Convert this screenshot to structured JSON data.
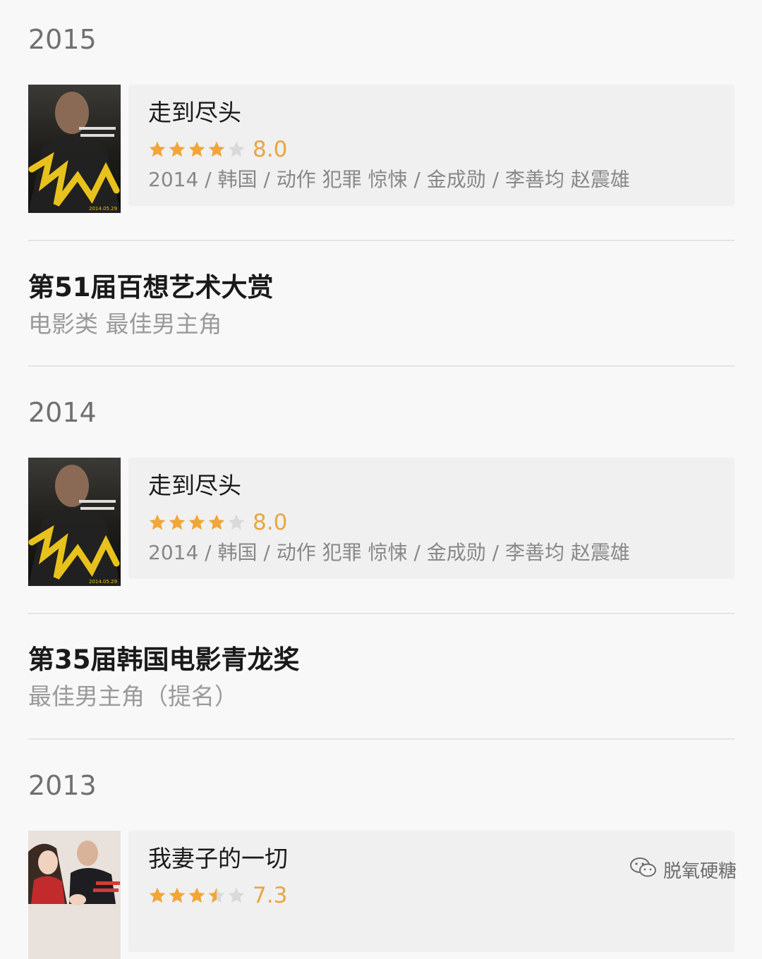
{
  "sections": [
    {
      "year": "2015",
      "movie": {
        "title": "走到尽头",
        "stars": 4,
        "score": "8.0",
        "meta": "2014 / 韩国 / 动作 犯罪 惊悚 / 金成勋 / 李善均 赵震雄",
        "poster_caption": "2014.05.29"
      },
      "award": {
        "name": "第51届百想艺术大赏",
        "category": "电影类 最佳男主角"
      }
    },
    {
      "year": "2014",
      "movie": {
        "title": "走到尽头",
        "stars": 4,
        "score": "8.0",
        "meta": "2014 / 韩国 / 动作 犯罪 惊悚 / 金成勋 / 李善均 赵震雄",
        "poster_caption": "2014.05.29"
      },
      "award": {
        "name": "第35届韩国电影青龙奖",
        "category": "最佳男主角（提名）"
      }
    },
    {
      "year": "2013",
      "movie": {
        "title": "我妻子的一切",
        "stars": 3.5,
        "score": "7.3"
      }
    }
  ],
  "watermark": {
    "text": "脱氧硬糖",
    "icon": "wechat-icon"
  },
  "colors": {
    "background": "#f8f8f8",
    "card": "#f0f0f0",
    "star_active": "#f0a73a",
    "star_inactive": "#d9d9d9",
    "score": "#e9a640"
  }
}
